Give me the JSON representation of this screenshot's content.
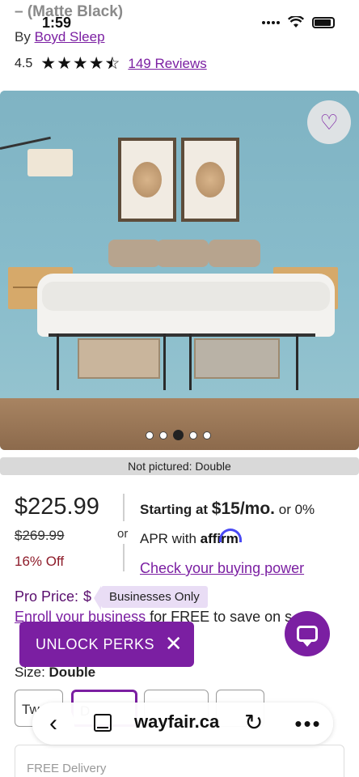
{
  "status_bar": {
    "time": "1:59"
  },
  "header": {
    "title_fragment": "– (Matte Black)",
    "by_prefix": "By",
    "brand": "Boyd Sleep",
    "rating_value": "4.5",
    "stars": 4.5,
    "reviews_label": "149 Reviews"
  },
  "gallery": {
    "favorite_icon": "heart-icon",
    "dot_count": 5,
    "active_dot": 3,
    "note": "Not pictured: Double"
  },
  "price": {
    "current": "$225.99",
    "original": "$269.99",
    "discount": "16% Off",
    "or": "or"
  },
  "financing": {
    "starting_at": "Starting at",
    "monthly": "$15/mo.",
    "or_zero": "or 0%",
    "apr_with": "APR with",
    "affirm": "affirm",
    "buying_power_link": "Check your buying power"
  },
  "pro": {
    "label": "Pro Price:",
    "value_fragment": "$",
    "tag": "Businesses Only",
    "enroll_link": "Enroll your business",
    "enroll_rest": "for FREE to save on s"
  },
  "unlock_banner": {
    "label": "UNLOCK PERKS",
    "close": "✕"
  },
  "size": {
    "label_prefix": "Size:",
    "selected": "Double",
    "options": [
      "Tw",
      "D",
      "",
      ""
    ]
  },
  "browser": {
    "back": "‹",
    "url": "wayfair.ca",
    "reload": "↻",
    "more": "•••"
  },
  "delivery": {
    "label": "FREE Delivery"
  },
  "colors": {
    "accent": "#7b1fa2",
    "discount": "#8e1c2a"
  }
}
